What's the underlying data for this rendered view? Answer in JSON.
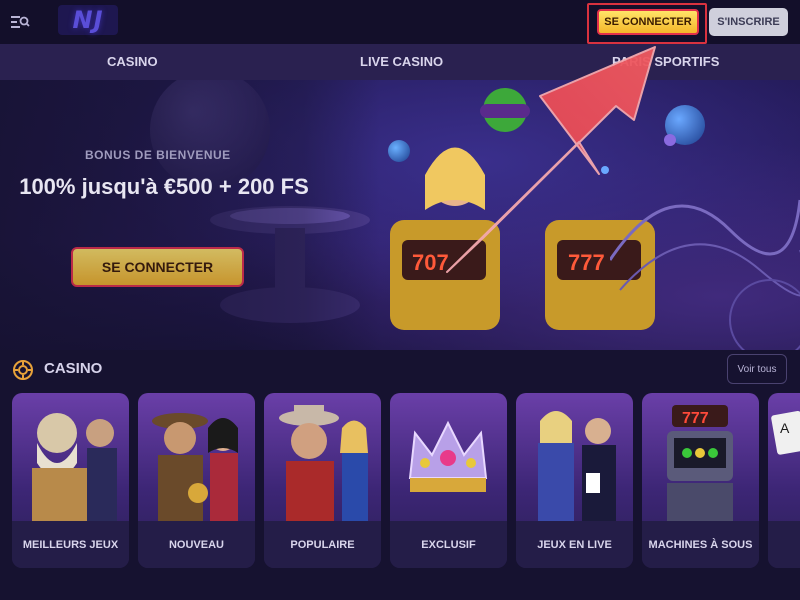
{
  "header": {
    "logo_text": "NJ",
    "login_label": "SE CONNECTER",
    "register_label": "S'INSCRIRE",
    "colors": {
      "login": "#f4b62a",
      "register": "#cfcfdc",
      "highlight": "#d9323f"
    }
  },
  "nav": {
    "items": [
      {
        "label": "CASINO"
      },
      {
        "label": "LIVE CASINO"
      },
      {
        "label": "PARIS SPORTIFS"
      }
    ]
  },
  "hero": {
    "label": "BONUS DE BIENVENUE",
    "title": "100% jusqu'à €500 + 200 FS",
    "cta_label": "SE CONNECTER"
  },
  "casino_section": {
    "title": "CASINO",
    "see_all_label": "Voir tous",
    "icon": "casino-chip-icon",
    "cards": [
      {
        "label": "MEILLEURS JEUX",
        "icon": "zeus-icon"
      },
      {
        "label": "NOUVEAU",
        "icon": "adventurer-icon"
      },
      {
        "label": "POPULAIRE",
        "icon": "cowboy-icon"
      },
      {
        "label": "EXCLUSIF",
        "icon": "crown-icon"
      },
      {
        "label": "JEUX EN LIVE",
        "icon": "dealers-icon"
      },
      {
        "label": "MACHINES À SOUS",
        "icon": "slot-machine-icon"
      },
      {
        "label": "",
        "icon": "cards-icon"
      }
    ]
  },
  "annotation": {
    "arrow_color": "#e4424c"
  }
}
